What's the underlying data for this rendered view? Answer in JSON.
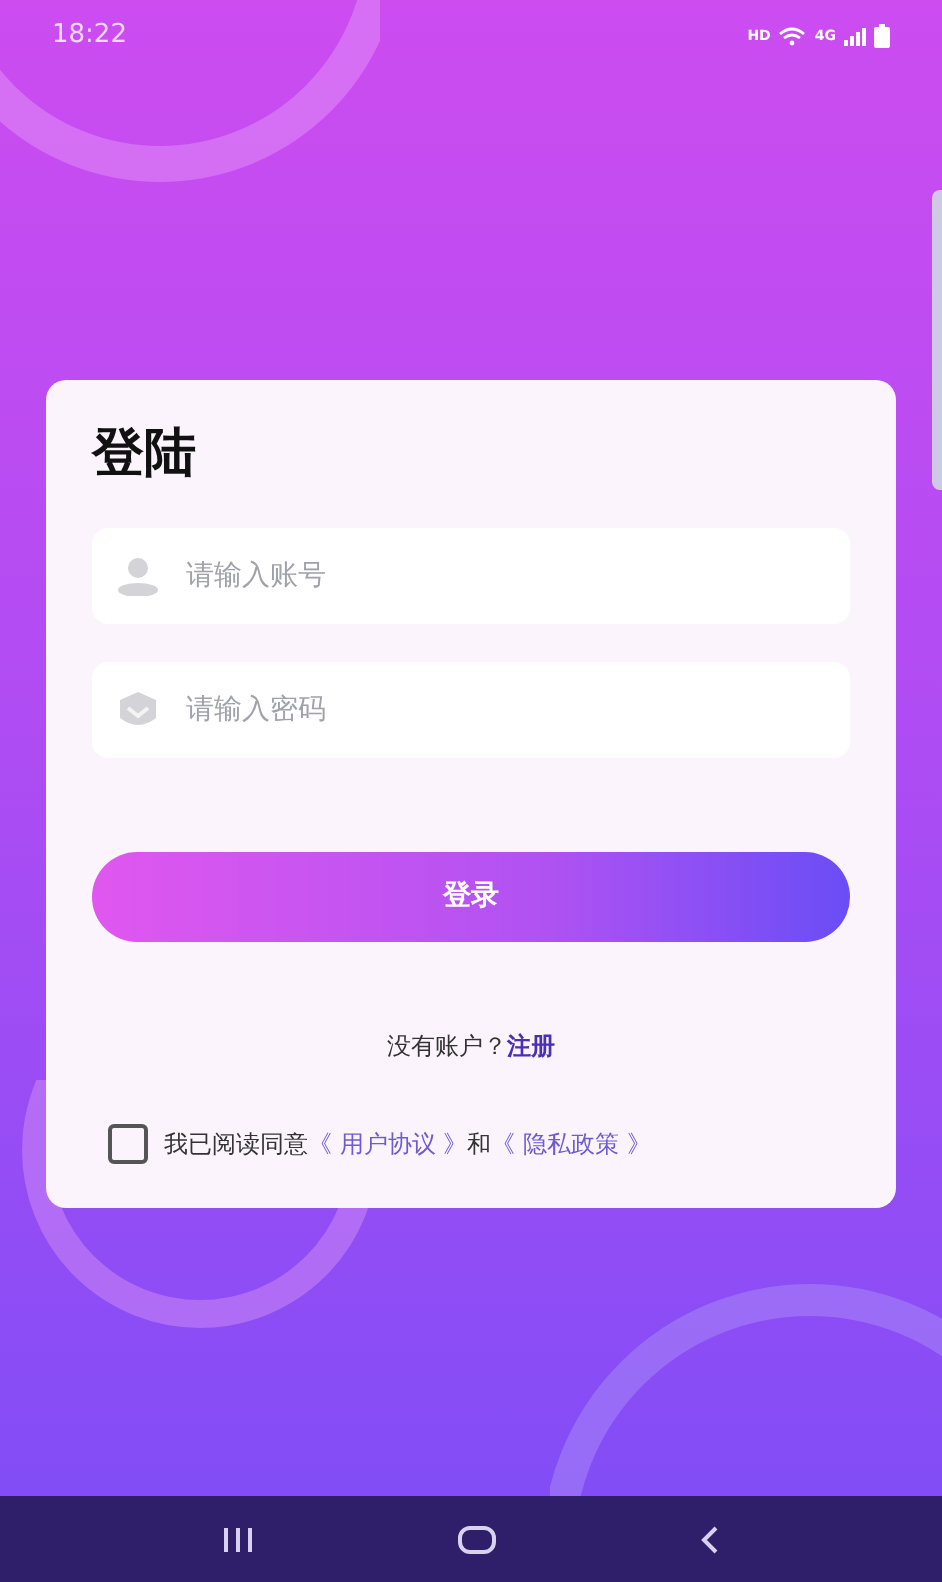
{
  "status_bar": {
    "time": "18:22",
    "hd": "HD",
    "network": "4G"
  },
  "login": {
    "title": "登陆",
    "fields": [
      {
        "kind": "account",
        "placeholder": "请输入账号"
      },
      {
        "kind": "password",
        "placeholder": "请输入密码"
      }
    ],
    "submit": "登录",
    "register_prompt": "没有账户？",
    "register_link": "注册",
    "agreement": {
      "checked": false,
      "text": "我已阅读同意",
      "user_agreement": "《 用户协议 》",
      "and": "和",
      "privacy_policy": "《 隐私政策 》"
    }
  }
}
